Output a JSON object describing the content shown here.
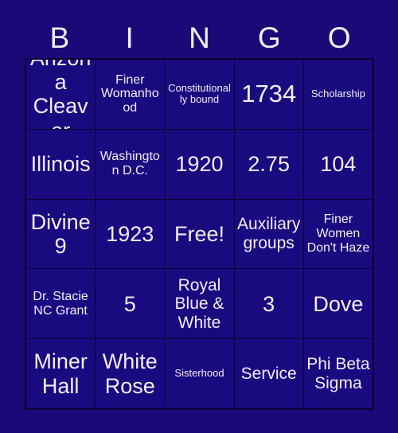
{
  "card": {
    "title": "BINGO",
    "colors": {
      "page_background": "#190a78",
      "cell_background": "#1a0a80",
      "grid_line": "#0a0330",
      "text": "#f2eef6"
    },
    "header": {
      "letters": [
        "B",
        "I",
        "N",
        "G",
        "O"
      ]
    },
    "rows": [
      [
        {
          "text": "Arizona Cleaver",
          "size": "lg"
        },
        {
          "text": "Finer Womanhood",
          "size": "sm"
        },
        {
          "text": "Constitutionally bound",
          "size": "xs"
        },
        {
          "text": "1734",
          "size": "xl"
        },
        {
          "text": "Scholarship",
          "size": "xs"
        }
      ],
      [
        {
          "text": "Illinois",
          "size": "lg"
        },
        {
          "text": "Washington D.C.",
          "size": "sm"
        },
        {
          "text": "1920",
          "size": "lg"
        },
        {
          "text": "2.75",
          "size": "lg"
        },
        {
          "text": "104",
          "size": "lg"
        }
      ],
      [
        {
          "text": "Divine 9",
          "size": "lg"
        },
        {
          "text": "1923",
          "size": "lg"
        },
        {
          "text": "Free!",
          "size": "lg"
        },
        {
          "text": "Auxiliary groups",
          "size": "md"
        },
        {
          "text": "Finer Women Don't Haze",
          "size": "sm"
        }
      ],
      [
        {
          "text": "Dr. Stacie NC Grant",
          "size": "sm"
        },
        {
          "text": "5",
          "size": "lg"
        },
        {
          "text": "Royal Blue & White",
          "size": "md"
        },
        {
          "text": "3",
          "size": "lg"
        },
        {
          "text": "Dove",
          "size": "lg"
        }
      ],
      [
        {
          "text": "Miner Hall",
          "size": "lg"
        },
        {
          "text": "White Rose",
          "size": "lg"
        },
        {
          "text": "Sisterhood",
          "size": "xs"
        },
        {
          "text": "Service",
          "size": "md"
        },
        {
          "text": "Phi Beta Sigma",
          "size": "md"
        }
      ]
    ]
  }
}
